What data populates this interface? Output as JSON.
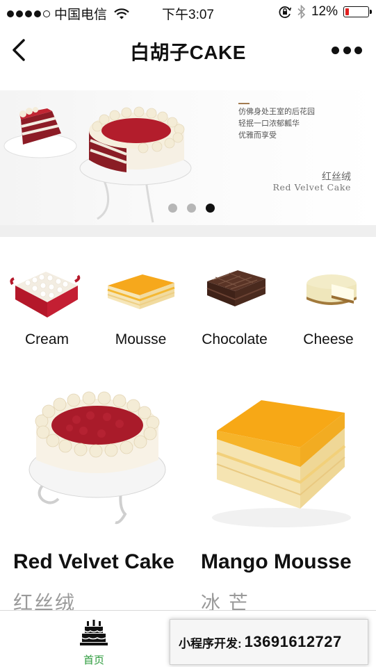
{
  "status_bar": {
    "carrier": "中国电信",
    "time": "下午3:07",
    "battery": "12%",
    "icons": [
      "signal-dots",
      "wifi-icon",
      "orientation-lock-icon",
      "bluetooth-icon",
      "battery-icon"
    ]
  },
  "nav": {
    "title": "白胡子CAKE",
    "back_icon": "chevron-left-icon",
    "more_icon": "more-dots-icon"
  },
  "banner": {
    "slogan": [
      "仿佛身处王室的后花园",
      "轻抿一口浓郁瓤华",
      "优雅而享受"
    ],
    "cake_name_cn": "红丝绒",
    "cake_name_en": "Red Velvet Cake",
    "slide_count": 3,
    "active_slide": 3
  },
  "categories": [
    {
      "label": "Cream"
    },
    {
      "label": "Mousse"
    },
    {
      "label": "Chocolate"
    },
    {
      "label": "Cheese"
    }
  ],
  "products": [
    {
      "name": "Red Velvet Cake",
      "name_cn": "红丝绒"
    },
    {
      "name": "Mango Mousse",
      "name_cn": "冰 芒"
    }
  ],
  "tab_bar": {
    "tabs": [
      {
        "label": "首页",
        "icon": "cake-icon",
        "active": true
      },
      {
        "label": "",
        "icon": "tab-icon",
        "active": false
      }
    ],
    "active_color": "#2a9a3a"
  },
  "dev_badge": {
    "label": "小程序开发:",
    "phone": "13691612727"
  }
}
